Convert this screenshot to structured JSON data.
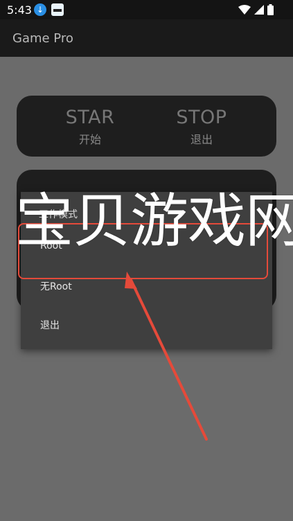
{
  "status_bar": {
    "time": "5:43",
    "icons": [
      "download-icon",
      "app-badge-icon",
      "wifi-icon",
      "signal-icon",
      "battery-icon"
    ]
  },
  "app_bar": {
    "title": "Game Pro"
  },
  "controls": {
    "start": {
      "label": "STAR",
      "sub": "开始"
    },
    "stop": {
      "label": "STOP",
      "sub": "退出"
    }
  },
  "menu": {
    "header": "工作模式",
    "items": [
      "Root",
      "无Root",
      "退出"
    ]
  },
  "watermark": "宝贝游戏网",
  "colors": {
    "background": "#6b6b6b",
    "card": "#1e1e1e",
    "menu": "#3f3f3f",
    "highlight": "#e54a3a"
  }
}
